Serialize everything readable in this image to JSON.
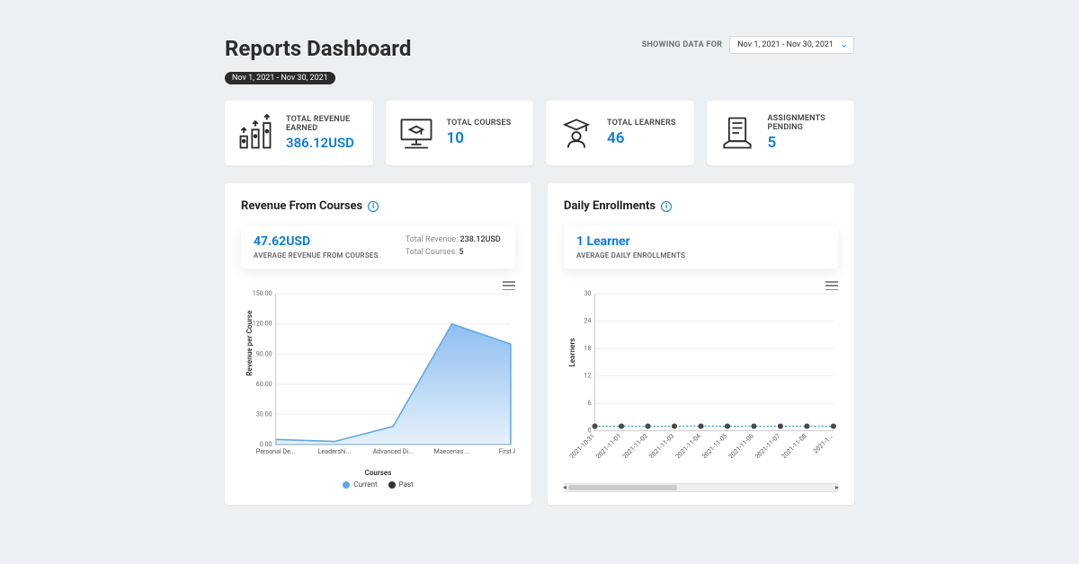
{
  "header": {
    "title": "Reports Dashboard",
    "date_pill": "Nov 1, 2021 - Nov 30, 2021",
    "showing_label": "SHOWING DATA FOR",
    "date_select_value": "Nov 1, 2021 - Nov 30, 2021"
  },
  "stats": [
    {
      "icon": "revenue-icon",
      "label": "TOTAL REVENUE EARNED",
      "value": "386.12USD"
    },
    {
      "icon": "courses-icon",
      "label": "TOTAL COURSES",
      "value": "10"
    },
    {
      "icon": "learners-icon",
      "label": "TOTAL LEARNERS",
      "value": "46"
    },
    {
      "icon": "assignments-icon",
      "label": "ASSIGNMENTS PENDING",
      "value": "5"
    }
  ],
  "revenue_panel": {
    "title": "Revenue From Courses",
    "avg_value": "47.62USD",
    "avg_label": "AVERAGE REVENUE FROM COURSES",
    "total_rev_label": "Total Revenue:",
    "total_rev_value": "238.12USD",
    "total_courses_label": "Total Courses:",
    "total_courses_value": "5",
    "y_axis_label": "Revenue per Course",
    "x_axis_label": "Courses",
    "legend_current": "Current",
    "legend_past": "Past"
  },
  "enroll_panel": {
    "title": "Daily Enrollments",
    "avg_value": "1 Learner",
    "avg_label": "AVERAGE DAILY ENROLLMENTS",
    "y_axis_label": "Learners"
  },
  "chart_data": [
    {
      "type": "area",
      "title": "Revenue From Courses",
      "xlabel": "Courses",
      "ylabel": "Revenue per Course",
      "ylim": [
        0,
        150
      ],
      "y_ticks": [
        0.0,
        30.0,
        60.0,
        90.0,
        120.0,
        150.0
      ],
      "categories": [
        "Personal De...",
        "Leadershi...",
        "Advanced Di...",
        "Maecenas ...",
        "First Aid"
      ],
      "series": [
        {
          "name": "Current",
          "color": "#5fa6e6",
          "values": [
            5,
            3,
            18,
            120,
            100
          ]
        },
        {
          "name": "Past",
          "color": "#333333",
          "values": null
        }
      ]
    },
    {
      "type": "line",
      "title": "Daily Enrollments",
      "xlabel": "",
      "ylabel": "Learners",
      "ylim": [
        0,
        30
      ],
      "y_ticks": [
        0,
        6,
        12,
        18,
        24,
        30
      ],
      "categories": [
        "2021-10-31",
        "2021-11-01",
        "2021-11-02",
        "2021-11-03",
        "2021-11-04",
        "2021-11-05",
        "2021-11-06",
        "2021-11-07",
        "2021-11-08",
        "2021-1..."
      ],
      "series": [
        {
          "name": "Enrollments",
          "color": "#0b7cd6",
          "values": [
            1,
            1,
            1,
            1,
            1,
            1,
            1,
            1,
            1,
            1
          ]
        }
      ]
    }
  ]
}
